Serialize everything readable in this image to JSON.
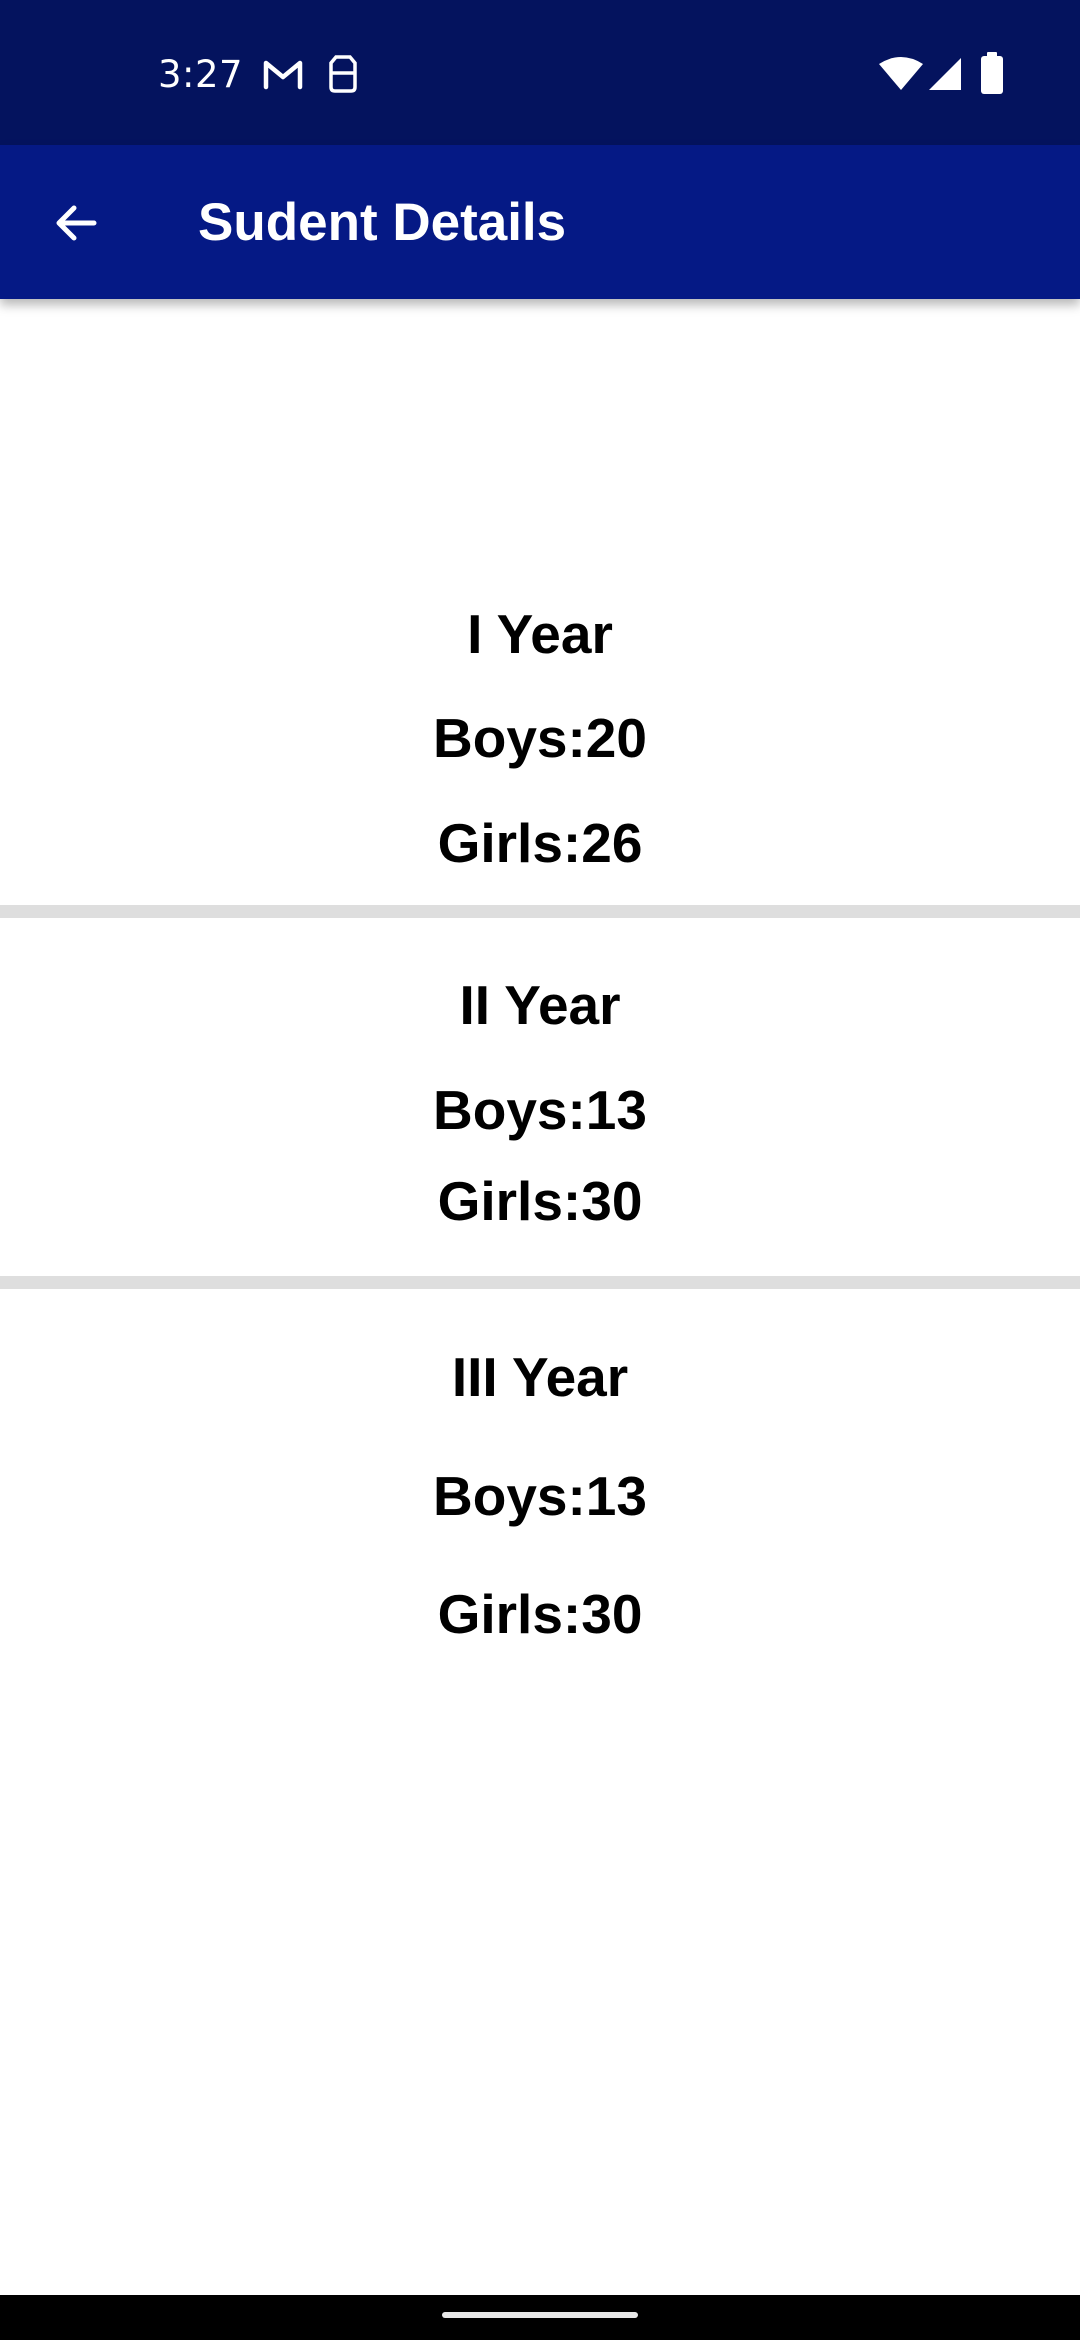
{
  "status_bar": {
    "time": "3:27",
    "left_icons": [
      "gmail-icon",
      "sim-card-icon"
    ],
    "right_icons": [
      "wifi-icon",
      "cell-signal-icon",
      "battery-icon"
    ]
  },
  "app_bar": {
    "title": "Sudent Details",
    "back_icon": "arrow-back-icon",
    "background": "#051985"
  },
  "years": [
    {
      "title": "I Year",
      "boys": "Boys:20",
      "girls": "Girls:26"
    },
    {
      "title": "II Year",
      "boys": "Boys:13",
      "girls": "Girls:30"
    },
    {
      "title": "III Year",
      "boys": "Boys:13",
      "girls": "Girls:30"
    }
  ],
  "colors": {
    "status_bar": "#04135e",
    "app_bar": "#051985",
    "divider": "#dedede",
    "text": "#000000"
  }
}
